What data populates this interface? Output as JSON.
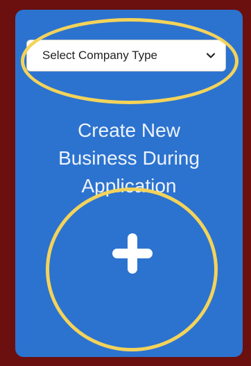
{
  "select": {
    "value": "Select Company Type"
  },
  "card": {
    "title_line1": "Create New",
    "title_line2": "Business During",
    "title_line3": "Application"
  },
  "colors": {
    "background": "#6b0f0f",
    "panel": "#2c73cf",
    "highlight": "#f3d35a"
  },
  "icons": {
    "dropdown": "chevron-down-icon",
    "add": "plus-icon"
  }
}
